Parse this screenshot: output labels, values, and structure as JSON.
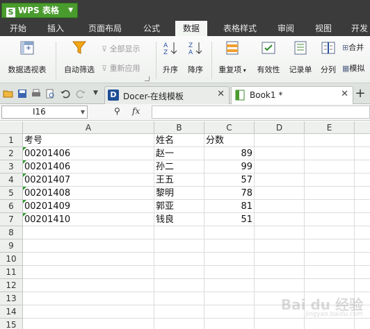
{
  "app": {
    "title": "WPS 表格",
    "logo_letter": "S"
  },
  "menu": {
    "items": [
      {
        "id": "start",
        "label": "开始"
      },
      {
        "id": "insert",
        "label": "插入"
      },
      {
        "id": "layout",
        "label": "页面布局"
      },
      {
        "id": "formula",
        "label": "公式"
      },
      {
        "id": "data",
        "label": "数据",
        "active": true
      },
      {
        "id": "table-style",
        "label": "表格样式"
      },
      {
        "id": "review",
        "label": "审阅"
      },
      {
        "id": "view",
        "label": "视图"
      },
      {
        "id": "dev",
        "label": "开发"
      }
    ]
  },
  "ribbon": {
    "pivot": "数据透视表",
    "autofilter": "自动筛选",
    "show_all": "全部显示",
    "reapply": "重新应用",
    "sort_asc": "升序",
    "sort_desc": "降序",
    "duplicates": "重复项",
    "validity": "有效性",
    "record": "记录单",
    "split": "分列",
    "merge": "合并",
    "simulate": "模拟"
  },
  "tabs": {
    "docer": "Docer-在线模板",
    "book": "Book1 *",
    "docer_logo": "D"
  },
  "formula_bar": {
    "cell_ref": "I16",
    "fx": "fx",
    "value": ""
  },
  "sheet": {
    "columns": [
      "A",
      "B",
      "C",
      "D",
      "E"
    ],
    "row_numbers": [
      "1",
      "2",
      "3",
      "4",
      "5",
      "6",
      "7",
      "8",
      "9",
      "10",
      "11",
      "12",
      "13",
      "14",
      "15"
    ],
    "header": {
      "a": "考号",
      "b": "姓名",
      "c": "分数"
    },
    "rows": [
      {
        "a": "00201406",
        "b": "赵一",
        "c": "89"
      },
      {
        "a": "00201406",
        "b": "孙二",
        "c": "99"
      },
      {
        "a": "00201407",
        "b": "王五",
        "c": "57"
      },
      {
        "a": "00201408",
        "b": "黎明",
        "c": "78"
      },
      {
        "a": "00201409",
        "b": "郭亚",
        "c": "81"
      },
      {
        "a": "00201410",
        "b": "钱良",
        "c": "51"
      }
    ]
  },
  "watermark": {
    "main": "Bai du 经验",
    "sub": "jingyan.baidu.com"
  },
  "colors": {
    "app_green": "#4a9b2e",
    "menu_bg": "#3b3b3b",
    "error_tri": "#2f9a2f"
  }
}
